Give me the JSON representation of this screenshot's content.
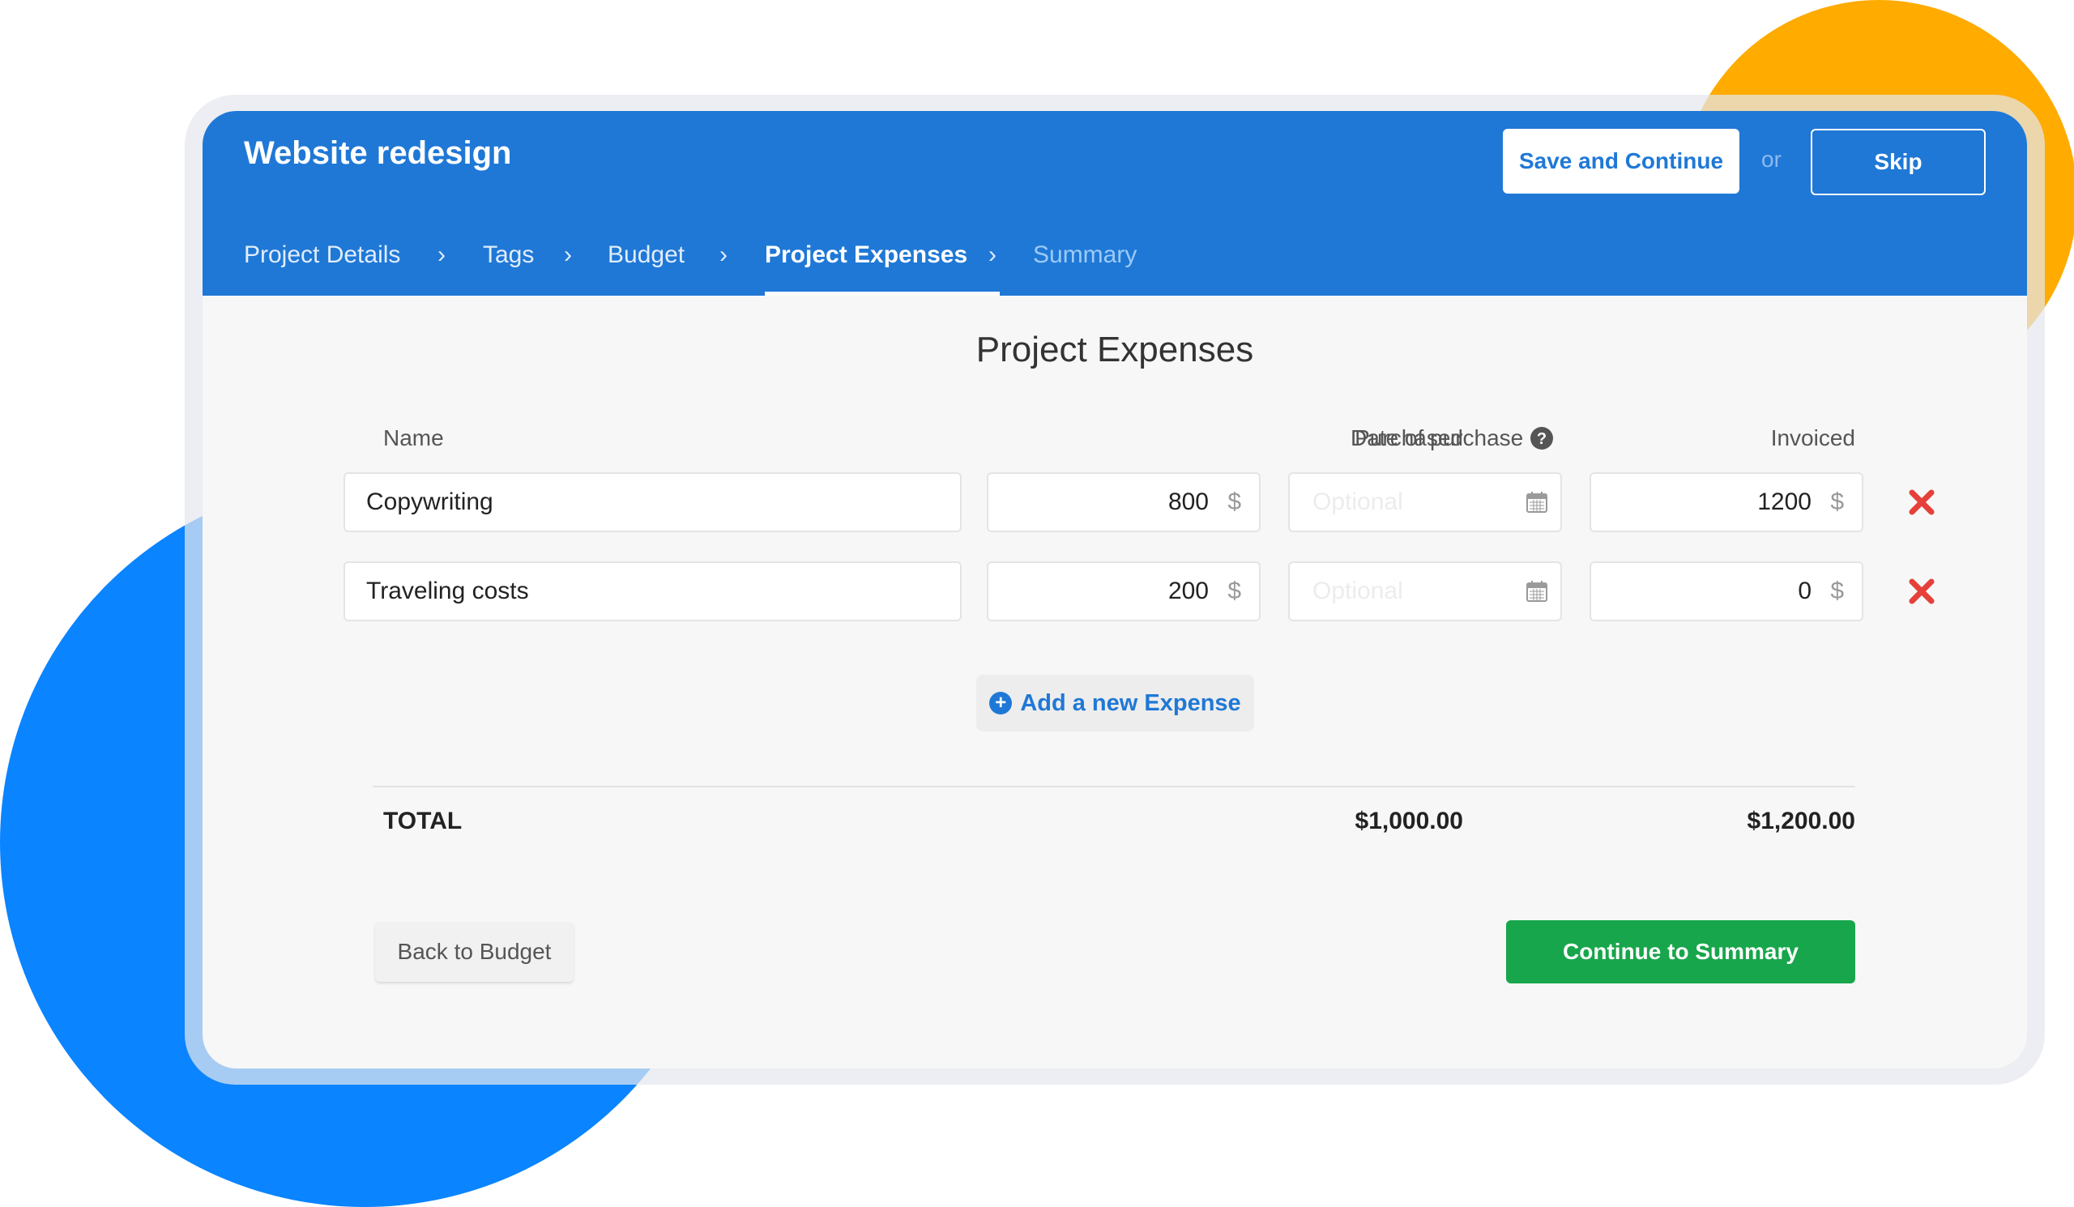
{
  "header": {
    "title": "Website redesign",
    "save_label": "Save and Continue",
    "or_label": "or",
    "skip_label": "Skip"
  },
  "steps": [
    {
      "label": "Project Details",
      "state": "done"
    },
    {
      "label": "Tags",
      "state": "done"
    },
    {
      "label": "Budget",
      "state": "done"
    },
    {
      "label": "Project Expenses",
      "state": "active"
    },
    {
      "label": "Summary",
      "state": "future"
    }
  ],
  "chevron": "›",
  "main": {
    "title": "Project Expenses",
    "columns": {
      "name": "Name",
      "purchased": "Purchased",
      "date": "Date of purchase",
      "invoiced": "Invoiced"
    },
    "currency": "$",
    "date_placeholder": "Optional",
    "expenses": [
      {
        "name": "Copywriting",
        "purchased": "800",
        "invoiced": "1200"
      },
      {
        "name": "Traveling costs",
        "purchased": "200",
        "invoiced": "0"
      }
    ],
    "add_label": "Add a new Expense",
    "total_label": "TOTAL",
    "total_purchased": "$1,000.00",
    "total_invoiced": "$1,200.00",
    "back_label": "Back to Budget",
    "continue_label": "Continue to Summary"
  },
  "colors": {
    "header_bg": "#1f78d6",
    "primary_green": "#17a64b",
    "delete_red": "#e5403a",
    "accent_orange": "#ffab00",
    "accent_blue": "#0a84ff"
  },
  "icons": {
    "help": "help-circle-icon",
    "calendar": "calendar-icon",
    "delete": "close-x-icon",
    "add": "plus-circle-icon",
    "chevron": "chevron-right-icon"
  }
}
